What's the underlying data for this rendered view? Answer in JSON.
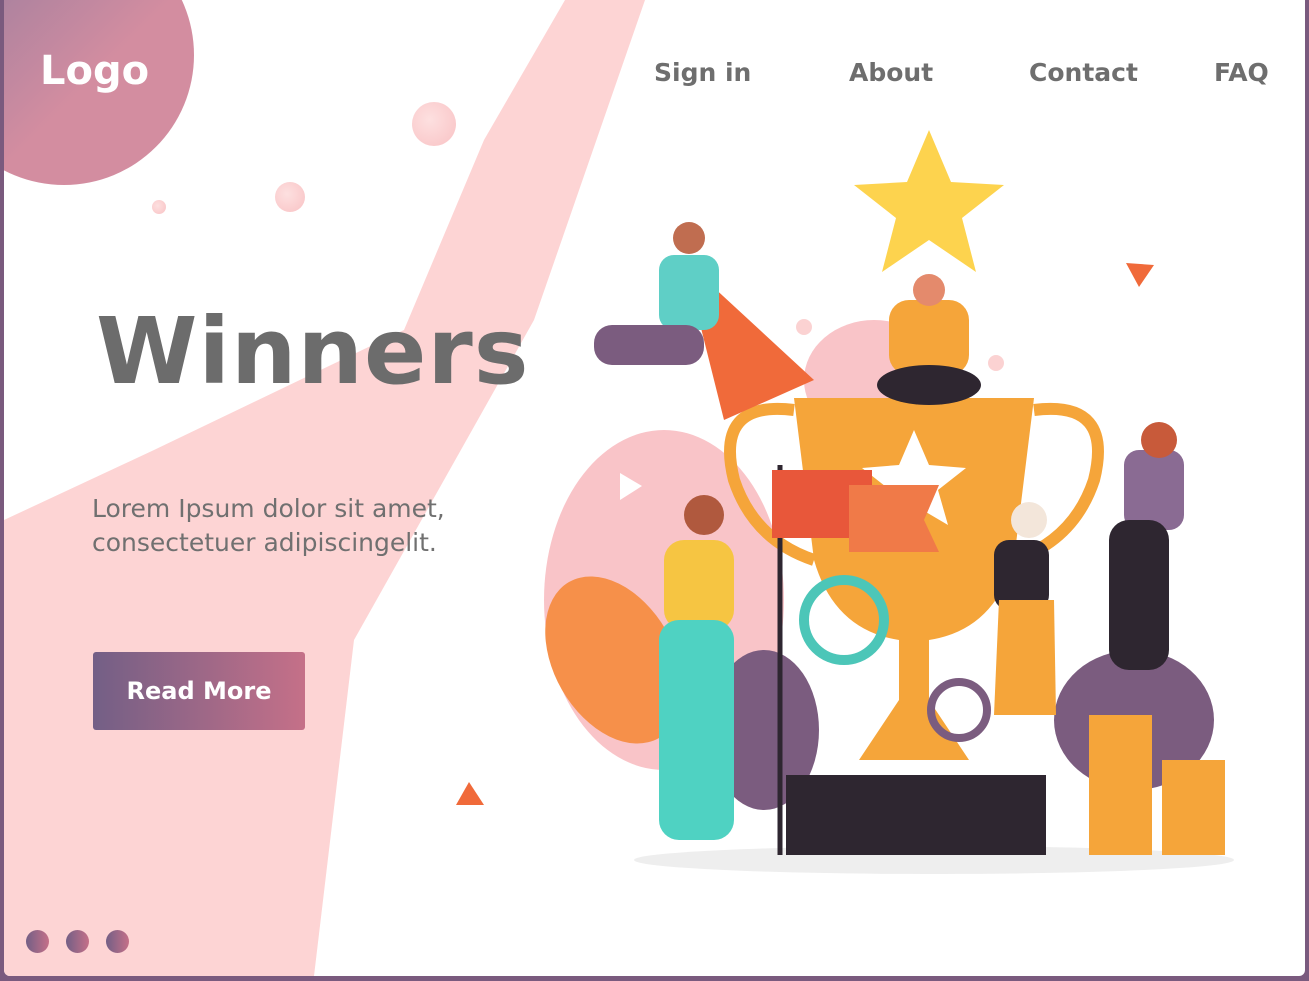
{
  "header": {
    "logo": "Logo",
    "nav": [
      {
        "label": "Sign in"
      },
      {
        "label": "About"
      },
      {
        "label": "Contact"
      },
      {
        "label": "FAQ"
      }
    ]
  },
  "hero": {
    "title": "Winners",
    "description_lines": [
      "Lorem Ipsum dolor sit amet,",
      "consectetuer adipiscingelit."
    ],
    "button_label": "Read More"
  },
  "slider": {
    "dots": 3
  },
  "colors": {
    "accent": "#735f86",
    "accent2": "#c57088",
    "pink": "#fdd4d4",
    "trophy": "#f5a53a",
    "star": "#fdd34e"
  }
}
